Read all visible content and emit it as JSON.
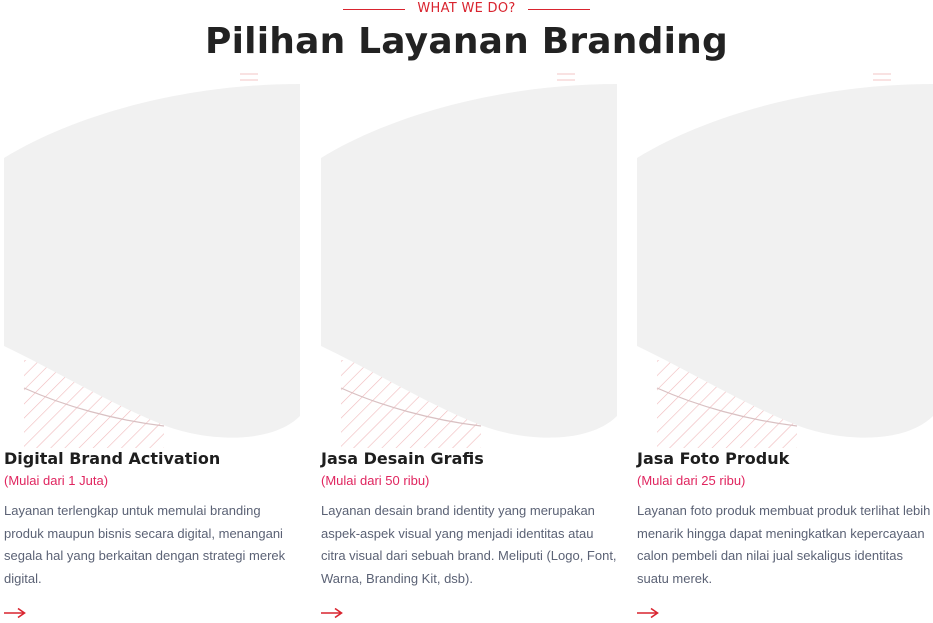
{
  "section": {
    "eyebrow": "WHAT WE DO?",
    "title": "Pilihan Layanan Branding"
  },
  "colors": {
    "accent": "#d9242f",
    "price": "#e0255f",
    "title": "#222222",
    "body_text": "#5b6275",
    "placeholder": "#f1f1f1",
    "hatch": "#f0b9bb"
  },
  "cards": [
    {
      "title": "Digital Brand Activation",
      "price": "(Mulai dari 1 Juta)",
      "description": "Layanan terlengkap untuk memulai branding produk maupun bisnis secara digital, menangani segala hal yang berkaitan dengan strategi merek digital.",
      "link_icon": "arrow-right-icon"
    },
    {
      "title": "Jasa Desain Grafis",
      "price": "(Mulai dari 50 ribu)",
      "description": "Layanan desain brand identity yang merupakan aspek-aspek visual yang menjadi identitas atau citra visual dari sebuah brand. Meliputi (Logo, Font, Warna, Branding Kit, dsb).",
      "link_icon": "arrow-right-icon"
    },
    {
      "title": "Jasa Foto Produk",
      "price": "(Mulai dari 25 ribu)",
      "description": "Layanan foto produk membuat produk terlihat lebih menarik hingga dapat meningkatkan kepercayaan calon pembeli dan nilai jual sekaligus identitas suatu merek.",
      "link_icon": "arrow-right-icon"
    }
  ]
}
